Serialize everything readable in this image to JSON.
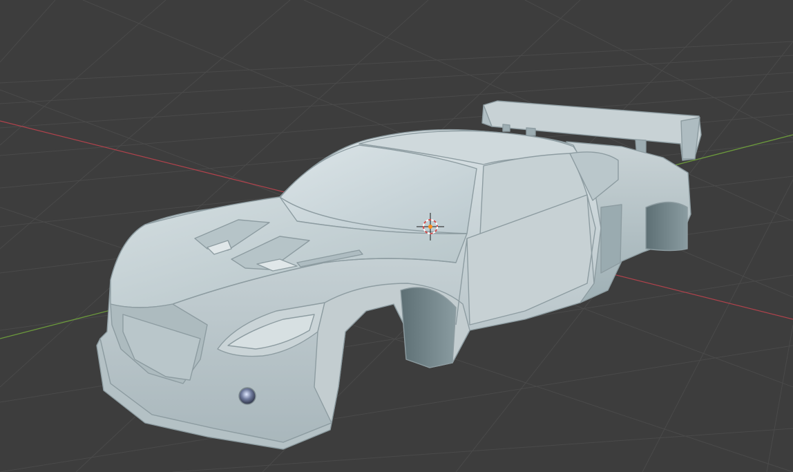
{
  "viewport": {
    "background_color": "#3d3d3d",
    "grid_line_color": "#4a4a4a",
    "x_axis_color": "#b0424c",
    "y_axis_color": "#6c9a3c",
    "shading": "solid",
    "object": "car-body-mesh",
    "object_color": "#c4cfd3",
    "shadow_color": "#7f9197"
  },
  "cursor_3d": {
    "icon": "3d-cursor-icon",
    "ring_color_a": "#d24c4c",
    "ring_color_b": "#ffffff",
    "center_color": "#ff8c1a"
  }
}
